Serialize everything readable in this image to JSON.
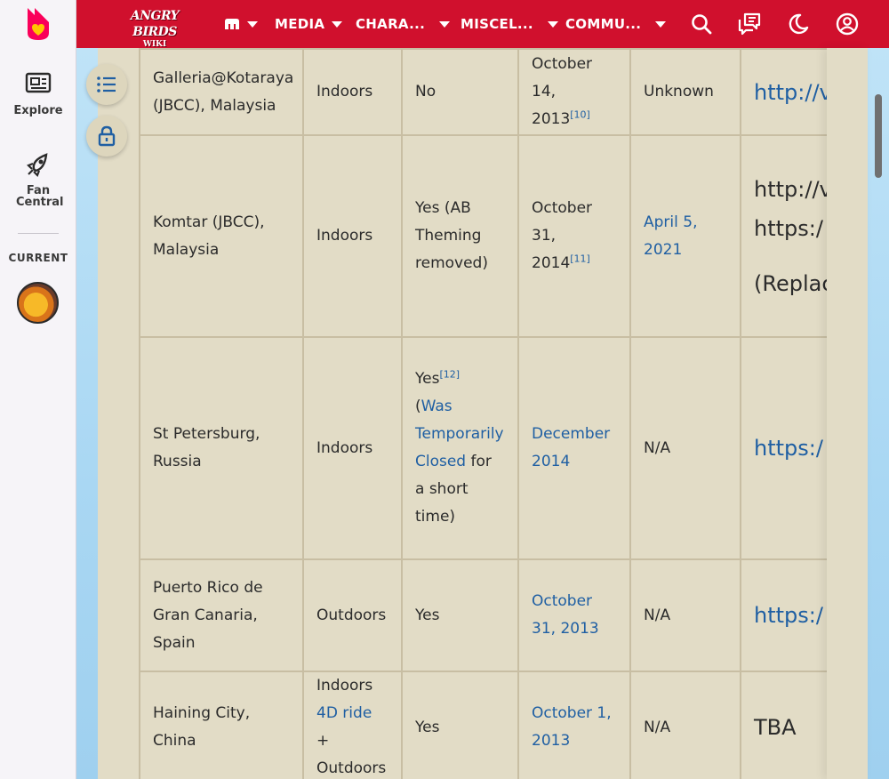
{
  "rail": {
    "explore_label": "Explore",
    "fan_central_label": "Fan Central",
    "current_label": "CURRENT"
  },
  "topbar": {
    "wordmark_line1": "ANGRY BIRDS",
    "wordmark_line2": "WIKI",
    "nav": [
      {
        "label": "MEDIA"
      },
      {
        "label": "CHARA..."
      },
      {
        "label": "MISCEL..."
      },
      {
        "label": "COMMU..."
      }
    ]
  },
  "table": {
    "rows": [
      {
        "location": "Galleria@Kotaraya (JBCC), Malaysia",
        "type": "Indoors",
        "status": "No",
        "opened": "October 14, 2013",
        "opened_ref": "[10]",
        "closed": "Unknown",
        "website": "http://v"
      },
      {
        "location": "Komtar (JBCC), Malaysia",
        "type": "Indoors",
        "status": "Yes (AB Theming removed)",
        "opened": "October 31, 2014",
        "opened_ref": "[11]",
        "closed": "April 5, 2021",
        "website_line1": "http://v",
        "website_line2": "https:/",
        "website_line3": "(Replac"
      },
      {
        "location": "St Petersburg, Russia",
        "type": "Indoors",
        "status_prefix": "Yes",
        "status_ref": "[12]",
        "status_link": "Was Temporarily Closed",
        "status_suffix": "for a short time)",
        "opened": "December 2014",
        "closed": "N/A",
        "website": "https:/"
      },
      {
        "location": "Puerto Rico de Gran Canaria, Spain",
        "type": "Outdoors",
        "status": "Yes",
        "opened": "October 31, 2013",
        "closed": "N/A",
        "website": "https:/"
      },
      {
        "location": "Haining City, China",
        "type_line1": "Indoors",
        "type_link": "4D ride",
        "type_line2": "Outdoors",
        "status": "Yes",
        "opened": "October 1, 2013",
        "closed": "N/A",
        "website": "TBA"
      }
    ]
  },
  "colors": {
    "brand_red": "#d0102d",
    "content_bg": "#e2dcc6",
    "link": "#1f5fa3"
  }
}
